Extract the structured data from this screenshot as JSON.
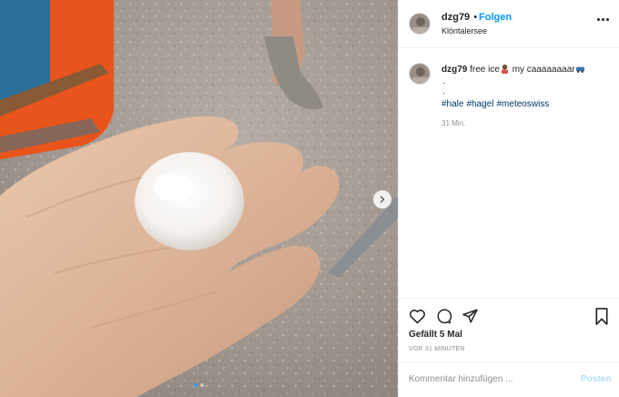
{
  "header": {
    "username": "dzg79",
    "separator": "•",
    "follow_label": "Folgen",
    "location": "Klöntalersee",
    "more_icon": "more-options-icon"
  },
  "caption": {
    "username": "dzg79",
    "text_before": " free ice",
    "text_middle": " my caaaaaaaar",
    "dot_1": ".",
    "dot_2": ".",
    "hashtags": [
      "#hale",
      "#hagel",
      "#meteoswiss"
    ],
    "age": "31 Min."
  },
  "actions": {
    "like_icon": "heart-icon",
    "comment_icon": "comment-bubble-icon",
    "share_icon": "paper-plane-icon",
    "save_icon": "bookmark-icon"
  },
  "likes": "Gefällt 5 Mal",
  "timestamp": "VOR 31 MINUTEN",
  "comment": {
    "placeholder": "Kommentar hinzufügen ...",
    "post_label": "Posten"
  },
  "carousel": {
    "current_slide": 1,
    "slide_count": 2
  },
  "colors": {
    "link": "#0095f6",
    "hashtag": "#00376b",
    "muted": "#8e8e8e",
    "post_disabled": "#b2dffc"
  }
}
